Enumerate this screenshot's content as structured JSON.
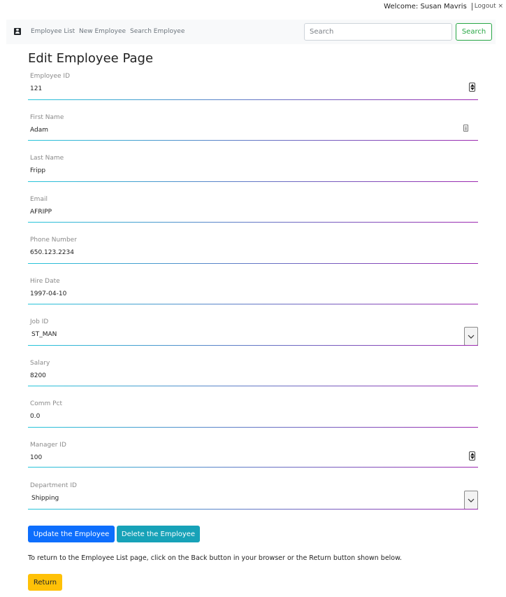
{
  "header": {
    "welcome": "Welcome: Susan Mavris",
    "logout": "Logout ×"
  },
  "nav": {
    "links": [
      "Employee List",
      "New Employee",
      "Search Employee"
    ],
    "search_placeholder": "Search",
    "search_button": "Search"
  },
  "page": {
    "title": "Edit Employee Page"
  },
  "form": {
    "employee_id": {
      "label": "Employee ID",
      "value": "121"
    },
    "first_name": {
      "label": "First Name",
      "value": "Adam"
    },
    "last_name": {
      "label": "Last Name",
      "value": "Fripp"
    },
    "email": {
      "label": "Email",
      "value": "AFRIPP"
    },
    "phone": {
      "label": "Phone Number",
      "value": "650.123.2234"
    },
    "hire_date": {
      "label": "Hire Date",
      "value": "1997-04-10"
    },
    "job_id": {
      "label": "Job ID",
      "value": "ST_MAN"
    },
    "salary": {
      "label": "Salary",
      "value": "8200"
    },
    "comm_pct": {
      "label": "Comm Pct",
      "value": "0.0"
    },
    "manager_id": {
      "label": "Manager ID",
      "value": "100"
    },
    "department_id": {
      "label": "Department ID",
      "value": "Shipping"
    }
  },
  "actions": {
    "update": "Update the Employee",
    "delete": "Delete the Employee",
    "info": "To return to the Employee List page, click on the Back button in your browser or the Return button shown below.",
    "return": "Return"
  },
  "colors": {
    "primary": "#0d6efd",
    "info": "#17a2b8",
    "warning": "#ffc107",
    "success": "#28a745"
  }
}
